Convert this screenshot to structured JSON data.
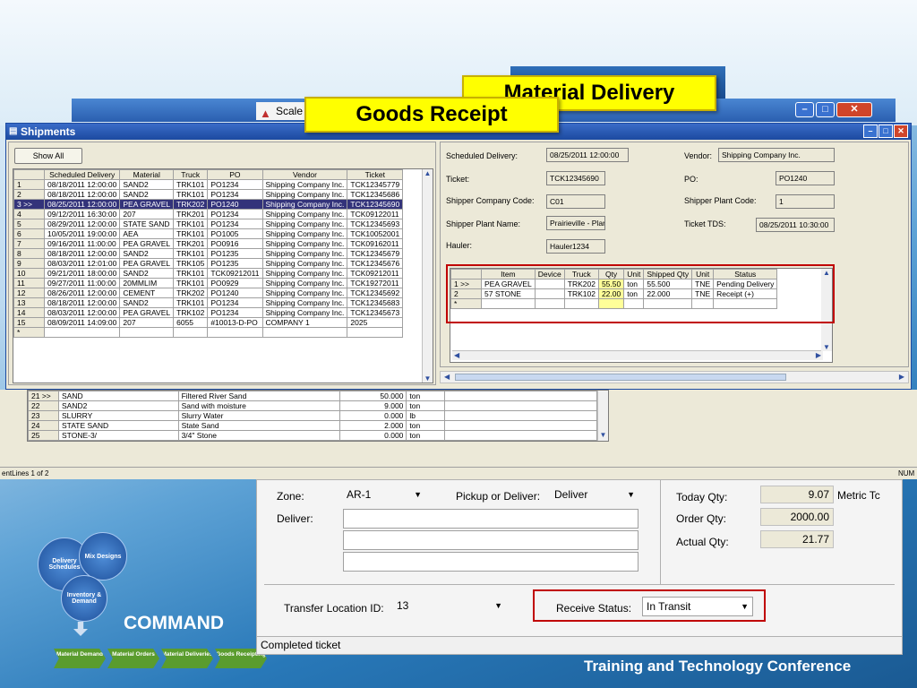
{
  "callouts": {
    "material_delivery": "Material Delivery",
    "goods_receipt": "Goods Receipt"
  },
  "bg_window": {
    "scale_title": "Scale"
  },
  "shipments": {
    "title": "Shipments",
    "show_all": "Show All",
    "columns": [
      "",
      "Scheduled Delivery",
      "Material",
      "Truck",
      "PO",
      "Vendor",
      "Ticket"
    ],
    "rows": [
      [
        "1",
        "08/18/2011 12:00:00",
        "SAND2",
        "TRK101",
        "PO1234",
        "Shipping Company Inc.",
        "TCK12345779"
      ],
      [
        "2",
        "08/18/2011 12:00:00",
        "SAND2",
        "TRK101",
        "PO1234",
        "Shipping Company Inc.",
        "TCK12345686"
      ],
      [
        "3 >>",
        "08/25/2011 12:00:00",
        "PEA GRAVEL",
        "TRK202",
        "PO1240",
        "Shipping Company Inc.",
        "TCK12345690"
      ],
      [
        "4",
        "09/12/2011 16:30:00",
        "207",
        "TRK201",
        "PO1234",
        "Shipping Company Inc.",
        "TCK09122011"
      ],
      [
        "5",
        "08/29/2011 12:00:00",
        "STATE SAND",
        "TRK101",
        "PO1234",
        "Shipping Company Inc.",
        "TCK12345693"
      ],
      [
        "6",
        "10/05/2011 19:00:00",
        "AEA",
        "TRK101",
        "PO1005",
        "Shipping Company Inc.",
        "TCK10052001"
      ],
      [
        "7",
        "09/16/2011 11:00:00",
        "PEA GRAVEL",
        "TRK201",
        "PO0916",
        "Shipping Company Inc.",
        "TCK09162011"
      ],
      [
        "8",
        "08/18/2011 12:00:00",
        "SAND2",
        "TRK101",
        "PO1235",
        "Shipping Company Inc.",
        "TCK12345679"
      ],
      [
        "9",
        "08/03/2011 12:01:00",
        "PEA GRAVEL",
        "TRK105",
        "PO1235",
        "Shipping Company Inc.",
        "TCK12345676"
      ],
      [
        "10",
        "09/21/2011 18:00:00",
        "SAND2",
        "TRK101",
        "TCK09212011",
        "Shipping Company Inc.",
        "TCK09212011"
      ],
      [
        "11",
        "09/27/2011 11:00:00",
        "20MMLIM",
        "TRK101",
        "PO0929",
        "Shipping Company Inc.",
        "TCK19272011"
      ],
      [
        "12",
        "08/26/2011 12:00:00",
        "CEMENT",
        "TRK202",
        "PO1240",
        "Shipping Company Inc.",
        "TCK12345692"
      ],
      [
        "13",
        "08/18/2011 12:00:00",
        "SAND2",
        "TRK101",
        "PO1234",
        "Shipping Company Inc.",
        "TCK12345683"
      ],
      [
        "14",
        "08/03/2011 12:00:00",
        "PEA GRAVEL",
        "TRK102",
        "PO1234",
        "Shipping Company Inc.",
        "TCK12345673"
      ],
      [
        "15",
        "08/09/2011 14:09:00",
        "207",
        "6055",
        "#10013-D-PO",
        "COMPANY 1",
        "2025"
      ],
      [
        "*",
        "",
        "",
        "",
        "",
        "",
        ""
      ]
    ],
    "detail": {
      "scheduled_delivery_label": "Scheduled Delivery:",
      "scheduled_delivery": "08/25/2011 12:00:00",
      "vendor_label": "Vendor:",
      "vendor": "Shipping Company Inc.",
      "ticket_label": "Ticket:",
      "ticket": "TCK12345690",
      "po_label": "PO:",
      "po": "PO1240",
      "shipper_company_code_label": "Shipper Company Code:",
      "shipper_company_code": "C01",
      "shipper_plant_code_label": "Shipper Plant Code:",
      "shipper_plant_code": "1",
      "shipper_plant_name_label": "Shipper Plant Name:",
      "shipper_plant_name": "Prairieville - Plan",
      "ticket_tds_label": "Ticket TDS:",
      "ticket_tds": "08/25/2011 10:30:00",
      "hauler_label": "Hauler:",
      "hauler": "Hauler1234"
    },
    "items_columns": [
      "",
      "Item",
      "Device",
      "Truck",
      "Qty",
      "Unit",
      "Shipped Qty",
      "Unit",
      "Status"
    ],
    "items_rows": [
      [
        "1 >>",
        "PEA GRAVEL",
        "",
        "TRK202",
        "55.50",
        "ton",
        "55.500",
        "TNE",
        "Pending Delivery"
      ],
      [
        "2",
        "57 STONE",
        "",
        "TRK102",
        "22.00",
        "ton",
        "22.000",
        "TNE",
        "Receipt (+)"
      ],
      [
        "*",
        "",
        "",
        "",
        "",
        "",
        "",
        "",
        ""
      ]
    ]
  },
  "materials_list": {
    "rows": [
      [
        "21 >>",
        "SAND",
        "Filtered River Sand",
        "50.000",
        "ton"
      ],
      [
        "22",
        "SAND2",
        "Sand with moisture",
        "9.000",
        "ton"
      ],
      [
        "23",
        "SLURRY",
        "Slurry Water",
        "0.000",
        "lb"
      ],
      [
        "24",
        "STATE SAND",
        "State Sand",
        "2.000",
        "ton"
      ],
      [
        "25",
        "STONE-3/",
        "3/4\" Stone",
        "0.000",
        "ton"
      ]
    ],
    "status_left": "entLines 1 of 2",
    "status_right": "NUM"
  },
  "receipt_window": {
    "zone_label": "Zone:",
    "zone_value": "AR-1",
    "pickup_label": "Pickup or Deliver:",
    "pickup_value": "Deliver",
    "deliver_label": "Deliver:",
    "today_qty_label": "Today Qty:",
    "today_qty": "9.07",
    "today_unit": "Metric Tc",
    "order_qty_label": "Order Qty:",
    "order_qty": "2000.00",
    "actual_qty_label": "Actual Qty:",
    "actual_qty": "21.77",
    "transfer_label": "Transfer Location ID:",
    "transfer_value": "13",
    "receive_status_label": "Receive Status:",
    "receive_status_value": "In Transit",
    "status_bar": "Completed ticket"
  },
  "slide": {
    "brand": "COMMAND",
    "conference": "Training and Technology Conference",
    "circles": {
      "delivery": "Delivery Schedules",
      "mix": "Mix Designs",
      "inventory": "Inventory & Demand"
    },
    "chevrons": [
      "Material Demand",
      "Material Orders",
      "Material Deliveries",
      "Goods Receipting"
    ]
  },
  "colors": {
    "callout_yellow": "#ffff00",
    "highlight_red": "#c00000",
    "selection": "#33337a",
    "qty_yellow": "#ffff99"
  }
}
